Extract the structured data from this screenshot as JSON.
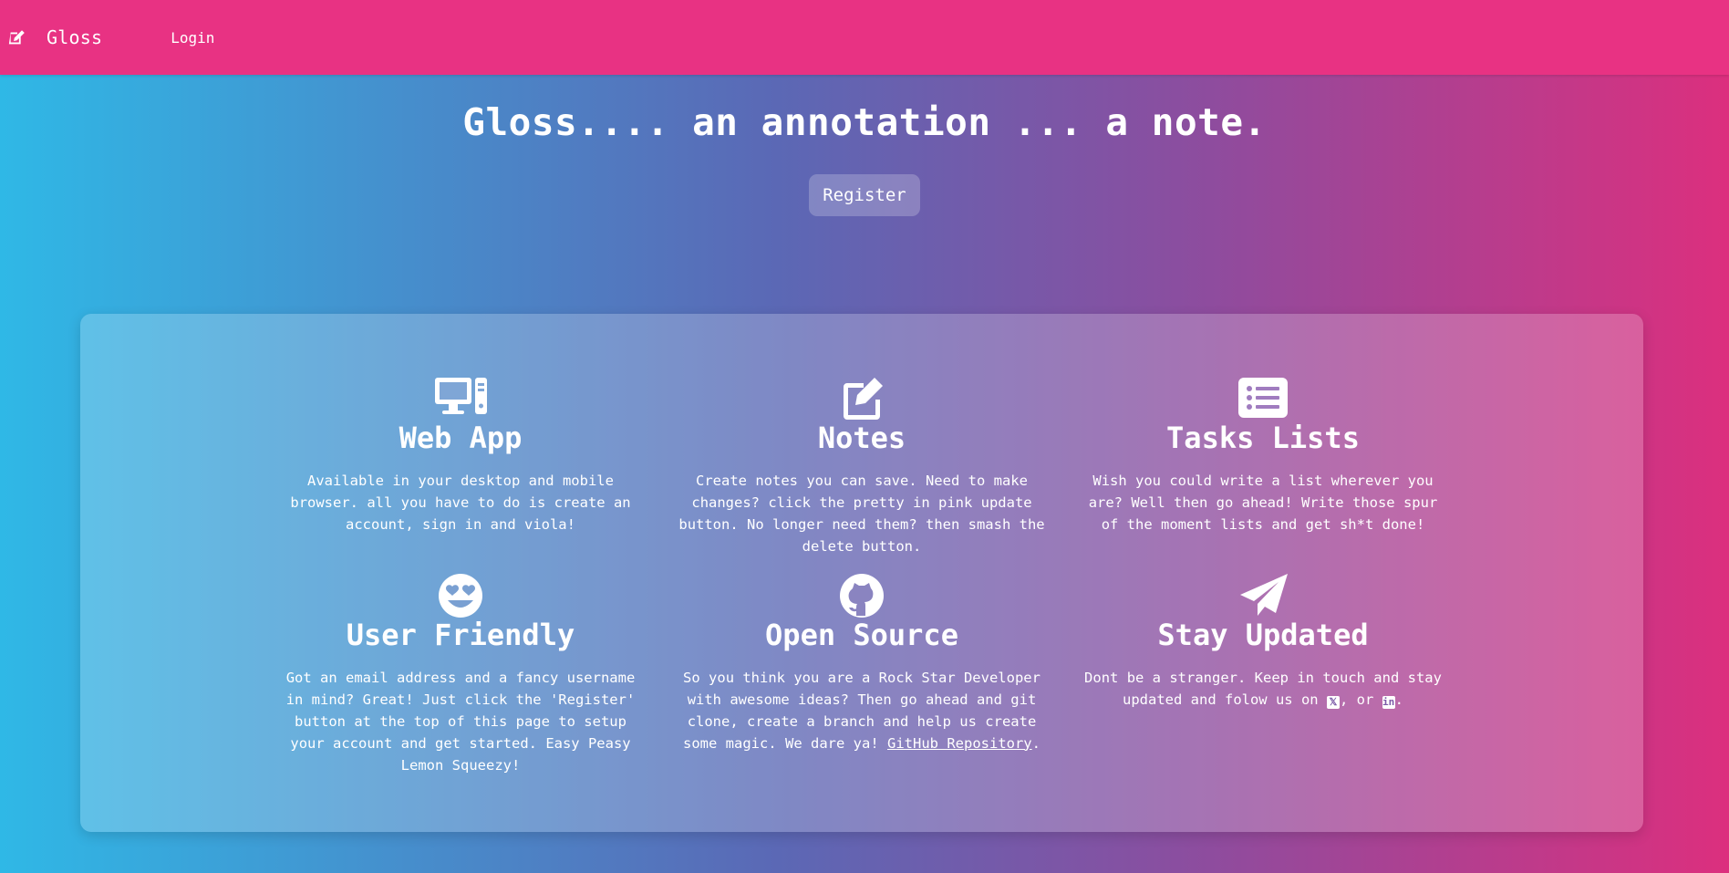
{
  "nav": {
    "brand": "Gloss",
    "login": "Login",
    "brand_icon": "edit-icon"
  },
  "hero": {
    "title": "Gloss.... an annotation ... a note.",
    "register": "Register"
  },
  "features": [
    {
      "icon": "desktop-computer-icon",
      "title": "Web App",
      "text": "Available in your desktop and mobile browser. all you have to do is create an account, sign in and viola!"
    },
    {
      "icon": "edit-icon",
      "title": "Notes",
      "text": "Create notes you can save. Need to make changes? click the pretty in pink update button. No longer need them? then smash the delete button."
    },
    {
      "icon": "list-icon",
      "title": "Tasks Lists",
      "text": "Wish you could write a list wherever you are? Well then go ahead! Write those spur of the moment lists and get sh*t done!"
    },
    {
      "icon": "heart-eyes-face-icon",
      "title": "User Friendly",
      "text": "Got an email address and a fancy username in mind? Great! Just click the 'Register' button at the top of this page to setup your account and get started. Easy Peasy Lemon Squeezy!"
    },
    {
      "icon": "github-icon",
      "title": "Open Source",
      "text": "So you think you are a Rock Star Developer with awesome ideas? Then go ahead and git clone, create a branch and help us create some magic. We dare ya!",
      "link": "GitHub Repository",
      "after": "."
    },
    {
      "icon": "paper-plane-icon",
      "title": "Stay Updated",
      "text": "Dont be a stranger. Keep in touch and stay updated and folow us on",
      "x_glyph": "𝕏",
      "mid": ", or",
      "li_glyph": "in",
      "after": "."
    }
  ],
  "colors": {
    "navbar": "#e83283",
    "gradient_start": "#2fb8e6",
    "gradient_mid": "#5b68b5",
    "gradient_end": "#dc2f7e"
  }
}
